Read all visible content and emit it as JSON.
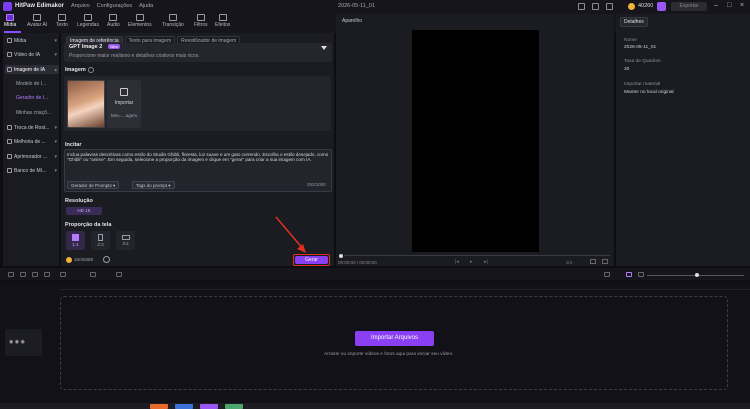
{
  "titlebar": {
    "app_name": "HitPaw Edimakor",
    "menu": [
      "Arquivo",
      "Configurações",
      "Ajuda"
    ],
    "date": "2026-05-11_01",
    "coins": "40260",
    "export_label": "Exportar"
  },
  "toolbar": {
    "items": [
      "Mídia",
      "Avatar AI",
      "Texto",
      "Legendas",
      "Áudio",
      "Elementos",
      "Transição",
      "Filtros",
      "Efeitos"
    ]
  },
  "leftnav": {
    "items": [
      {
        "label": "Mídia"
      },
      {
        "label": "Vídeo de IA"
      },
      {
        "label": "Imagem de IA"
      },
      {
        "label": "Troca de Rost..."
      },
      {
        "label": "Melhoria de ..."
      },
      {
        "label": "Aprimorador ..."
      },
      {
        "label": "Banco de Mí..."
      }
    ],
    "subitems": [
      "Modelo de I...",
      "Gerador de I...",
      "Minhas criaçõ..."
    ]
  },
  "panel": {
    "tabs": [
      "Imagem de referência",
      "Texto para imagem",
      "Reestilizador de imagem"
    ],
    "model_title": "GPT Image 2",
    "model_badge": "New",
    "model_desc": "Proporcione maior realismo e detalhes criativos mais ricos.",
    "image_label": "Imagem",
    "upload_label": "Importar",
    "upload_sub": "Meu.....agem",
    "prompt_label": "Incitar",
    "prompt_text": "Inclua palavras descritivas como estilo do Studio Ghibli, floresta, luz suave e um gato correndo. Escolha o estilo desejado, como \"Ghibli\" ou \"anime\". Em seguida, selecione a proporção da imagem e clique em \"gerar\" para criar a sua imagem com IA.",
    "prompt_gen_label": "Gerador de Prompts",
    "prompt_tags_label": "Tags do prompt",
    "char_count": "252/1000",
    "resolution_label": "Resolução",
    "resolution_value": "HD 1K",
    "ratio_label": "Proporção da tela",
    "ratios": [
      "1:1",
      "2:3",
      "3:2"
    ],
    "credits": "10/40260",
    "generate_label": "Gerar"
  },
  "preview": {
    "title": "Aparelho",
    "time": "00:00:00 / 00:00:00",
    "zoom": "3/4"
  },
  "details": {
    "tab": "Detalhes",
    "fields": [
      {
        "label": "Nome",
        "value": "2026-05-11_01"
      },
      {
        "label": "Taxa de Quadros",
        "value": "30"
      },
      {
        "label": "Importar material",
        "value": "Manter no local original"
      }
    ]
  },
  "timeline": {
    "import_label": "Importar Arquivos",
    "drop_hint": "Arraste ou importe vídeos e fotos aqui para iniciar seu vídeo."
  }
}
